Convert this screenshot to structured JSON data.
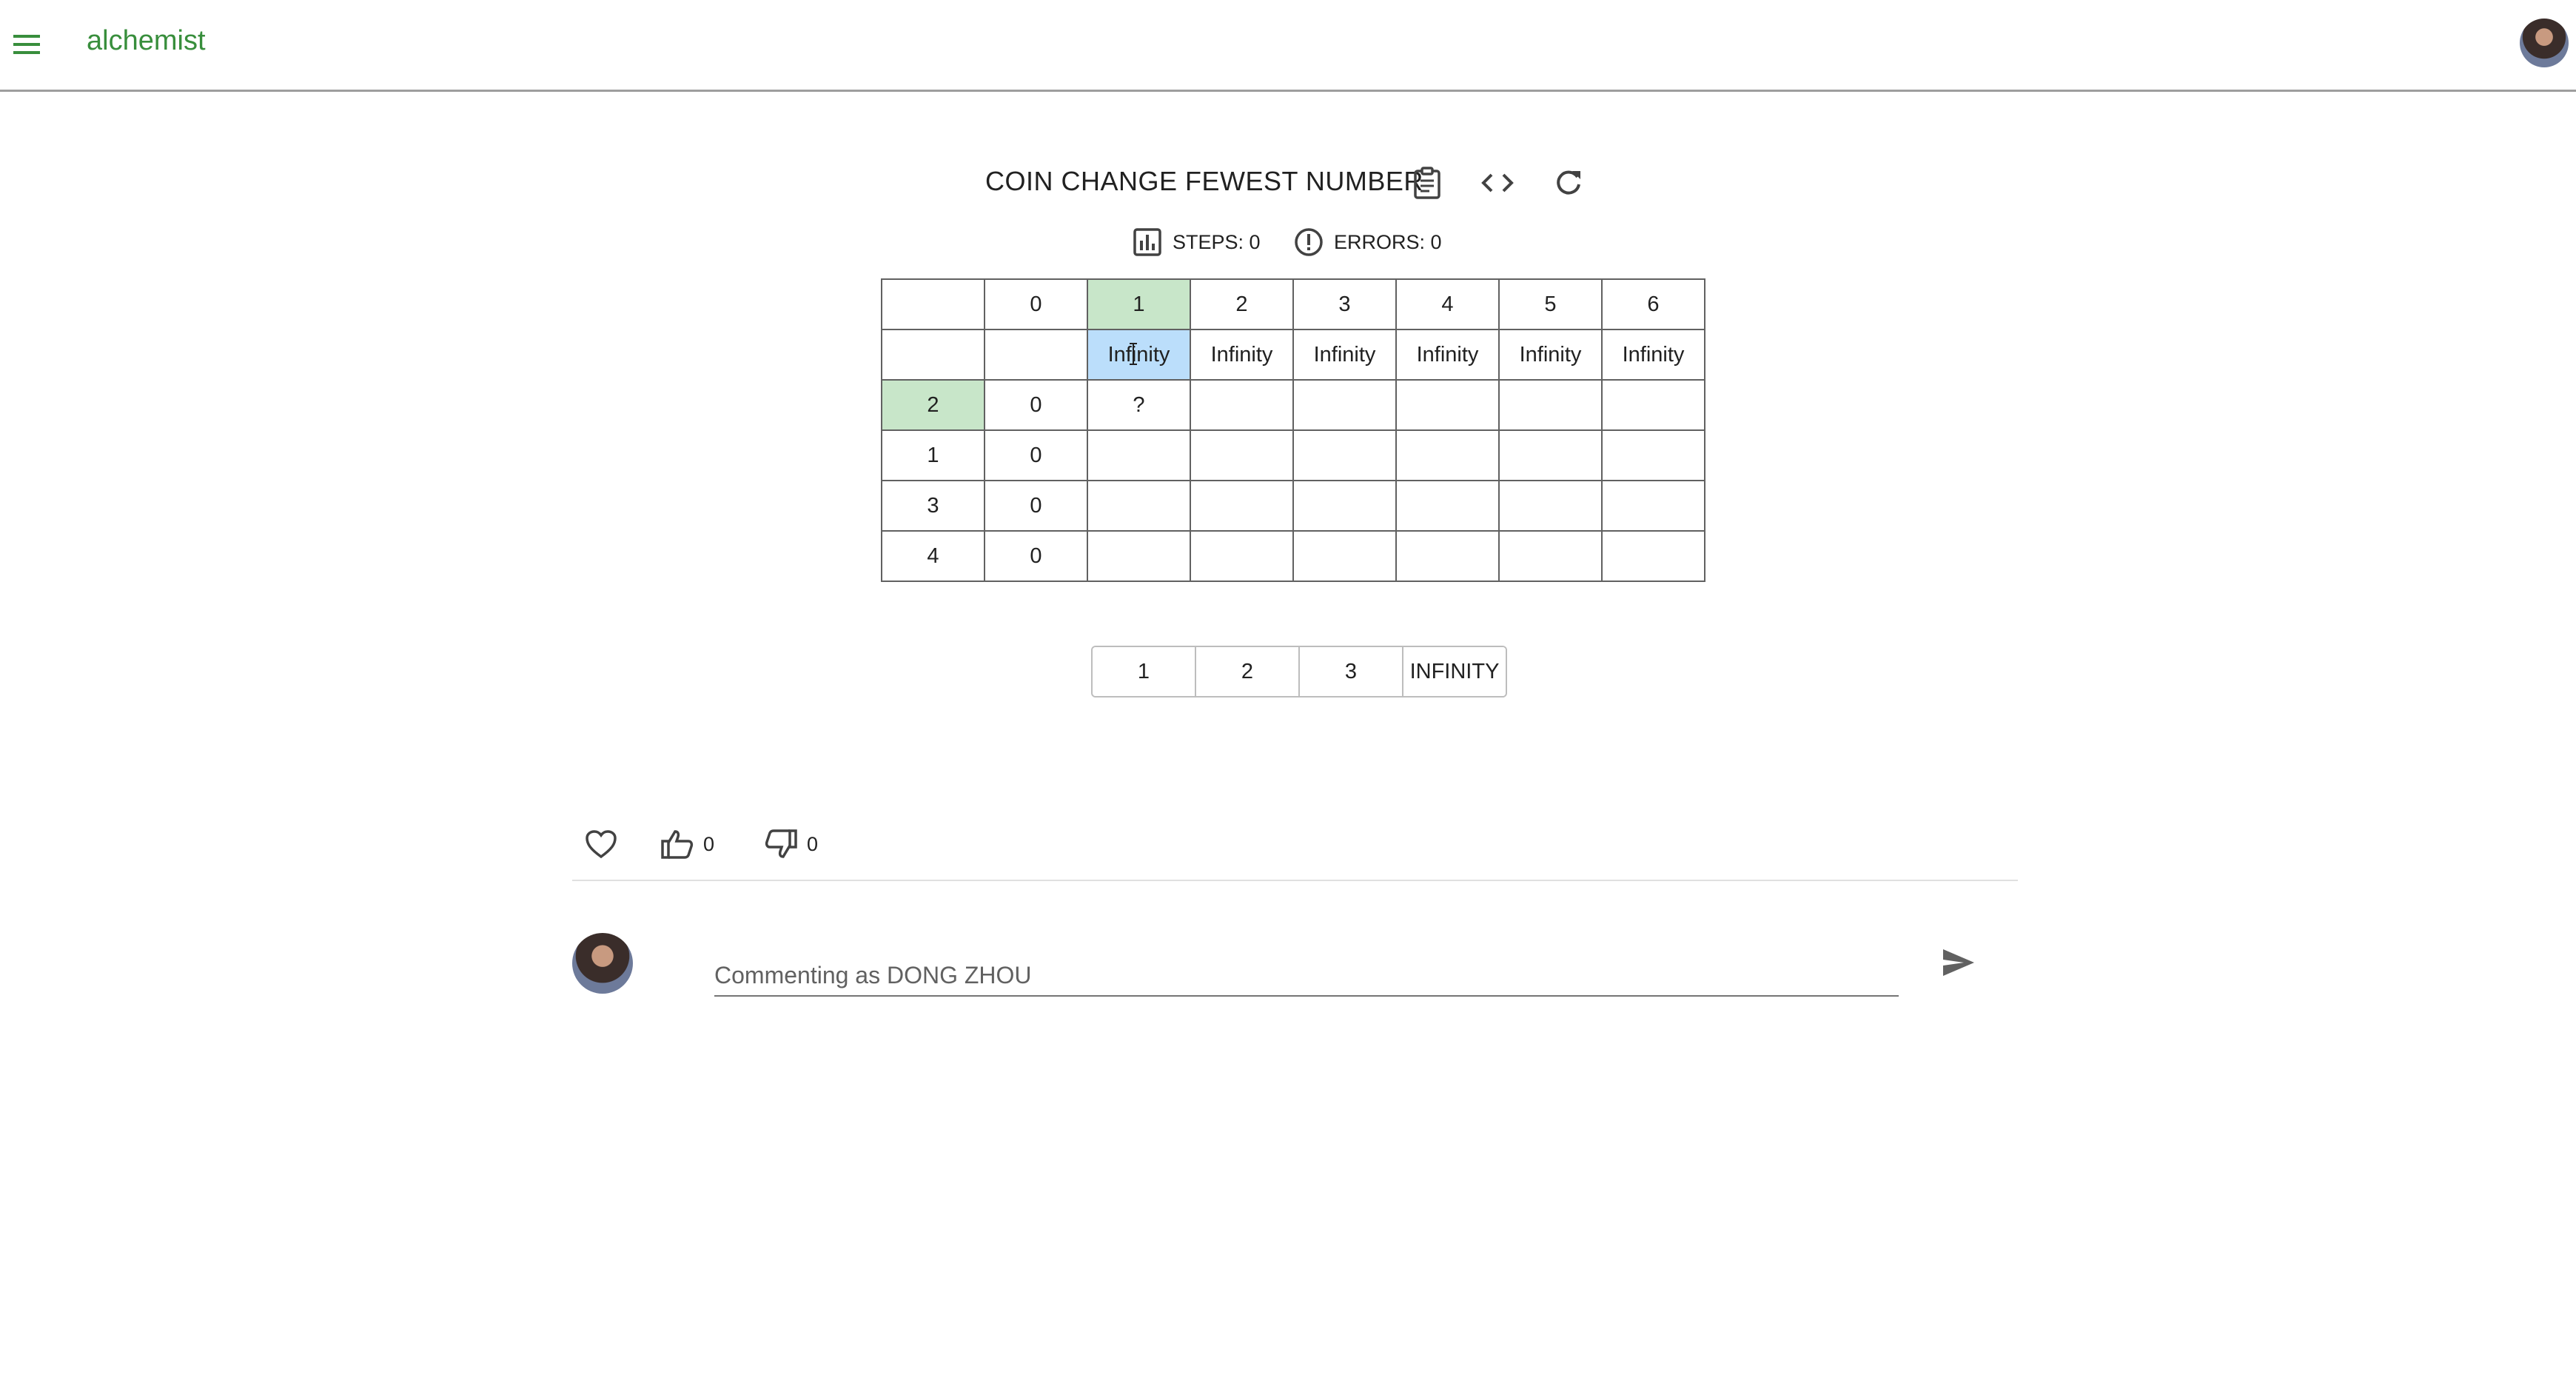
{
  "app": {
    "brand": "alchemist",
    "menu_icon": "menu-icon",
    "user_avatar": "user-avatar"
  },
  "problem": {
    "title": "COIN CHANGE FEWEST NUMBER",
    "icons": [
      "clipboard-icon",
      "code-icon",
      "refresh-icon"
    ]
  },
  "stats": {
    "steps": "STEPS: 0",
    "errors": "ERRORS: 0"
  },
  "table": {
    "rows": [
      [
        "",
        "0",
        "1",
        "2",
        "3",
        "4",
        "5",
        "6"
      ],
      [
        "",
        "",
        "Infinity",
        "Infinity",
        "Infinity",
        "Infinity",
        "Infinity",
        "Infinity"
      ],
      [
        "2",
        "0",
        "?",
        "",
        "",
        "",
        "",
        ""
      ],
      [
        "1",
        "0",
        "",
        "",
        "",
        "",
        "",
        ""
      ],
      [
        "3",
        "0",
        "",
        "",
        "",
        "",
        "",
        ""
      ],
      [
        "4",
        "0",
        "",
        "",
        "",
        "",
        "",
        ""
      ]
    ],
    "highlight_green": "#c8e6c9",
    "highlight_blue": "#bbdefb"
  },
  "choices": [
    "1",
    "2",
    "3",
    "INFINITY"
  ],
  "reactions": {
    "likes": "0",
    "dislikes": "0"
  },
  "comment": {
    "placeholder": "Commenting as DONG ZHOU"
  },
  "colors": {
    "brand": "#388e3c",
    "text": "#212121"
  }
}
